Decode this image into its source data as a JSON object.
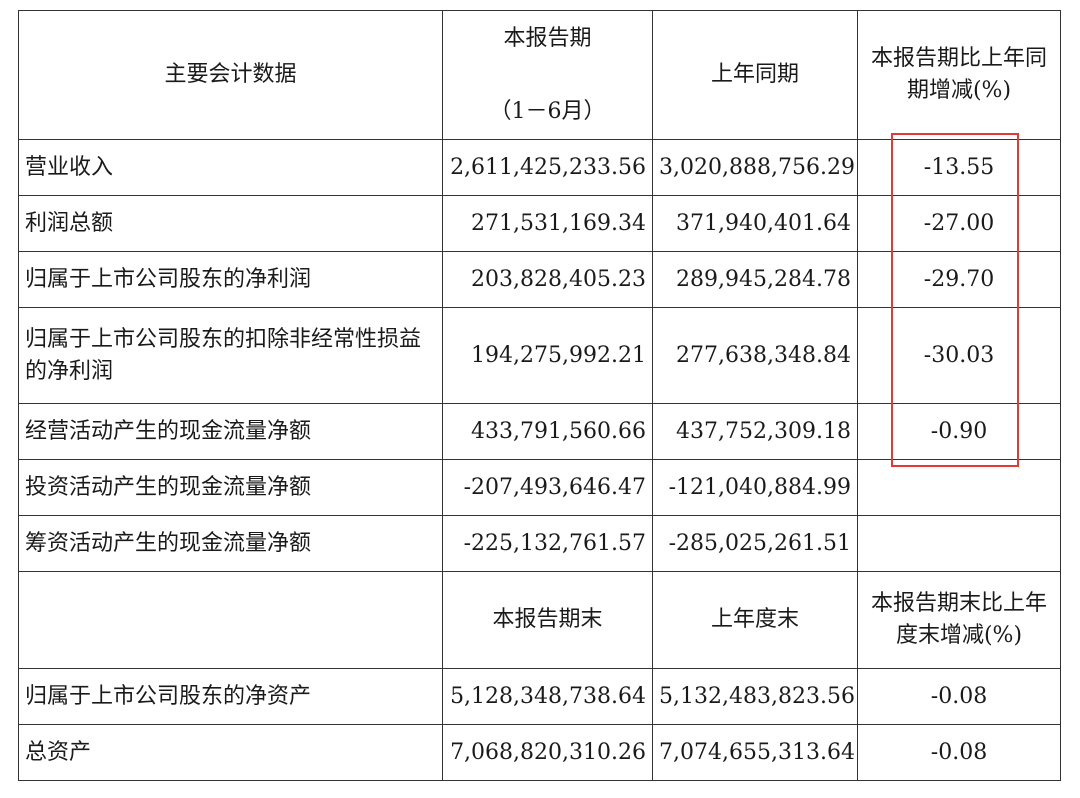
{
  "table": {
    "header": {
      "item": "主要会计数据",
      "current_period_line1": "本报告期",
      "current_period_line2": "（1－6月）",
      "prior_period": "上年同期",
      "change": "本报告期比上年同期增减(%)"
    },
    "rows": [
      {
        "label": "营业收入",
        "current": "2,611,425,233.56",
        "prior": "3,020,888,756.29",
        "change": "-13.55"
      },
      {
        "label": "利润总额",
        "current": "271,531,169.34",
        "prior": "371,940,401.64",
        "change": "-27.00"
      },
      {
        "label": "归属于上市公司股东的净利润",
        "current": "203,828,405.23",
        "prior": "289,945,284.78",
        "change": "-29.70"
      },
      {
        "label": "归属于上市公司股东的扣除非经常性损益的净利润",
        "current": "194,275,992.21",
        "prior": "277,638,348.84",
        "change": "-30.03"
      },
      {
        "label": "经营活动产生的现金流量净额",
        "current": "433,791,560.66",
        "prior": "437,752,309.18",
        "change": "-0.90"
      },
      {
        "label": "投资活动产生的现金流量净额",
        "current": "-207,493,646.47",
        "prior": "-121,040,884.99",
        "change": ""
      },
      {
        "label": "筹资活动产生的现金流量净额",
        "current": "-225,132,761.57",
        "prior": "-285,025,261.51",
        "change": ""
      }
    ],
    "subheader": {
      "item": "",
      "current_end": "本报告期末",
      "prior_end": "上年度末",
      "change": "本报告期末比上年度末增减(%)"
    },
    "rows2": [
      {
        "label": "归属于上市公司股东的净资产",
        "current": "5,128,348,738.64",
        "prior": "5,132,483,823.56",
        "change": "-0.08"
      },
      {
        "label": "总资产",
        "current": "7,068,820,310.26",
        "prior": "7,074,655,313.64",
        "change": "-0.08"
      }
    ]
  },
  "highlight_color": "#e53935"
}
